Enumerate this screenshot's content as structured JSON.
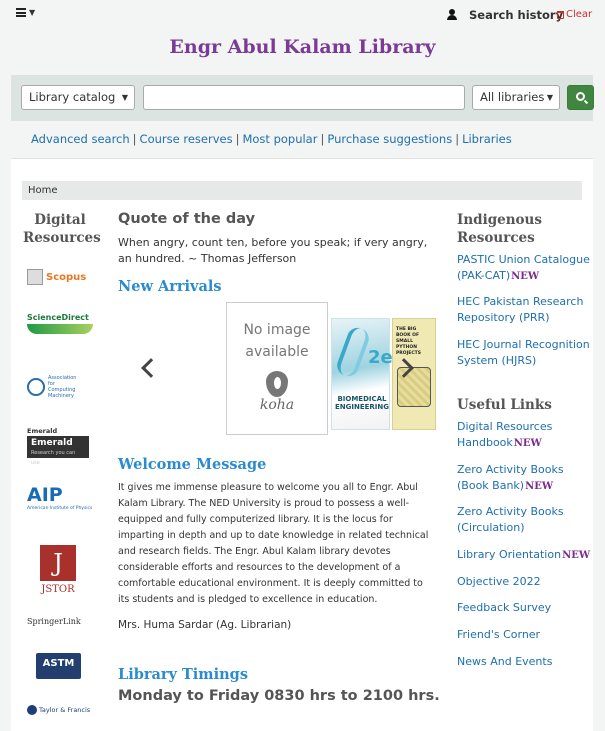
{
  "header": {
    "search_history": "Search history",
    "clear": "Clear"
  },
  "library_title": "Engr Abul Kalam Library",
  "search": {
    "scope": "Library catalog",
    "query": "",
    "branch": "All libraries"
  },
  "more_searches": [
    "Advanced search",
    "Course reserves",
    "Most popular",
    "Purchase suggestions",
    "Libraries"
  ],
  "breadcrumb": "Home",
  "left_col": {
    "heading_l1": "Digital",
    "heading_l2": "Resources",
    "logos": {
      "scopus": "Scopus",
      "sciencedirect": "ScienceDirect",
      "acm": "Association for Computing Machinery",
      "emerald_top": "Emerald",
      "emerald_name": "Emerald",
      "emerald_tag": "Research you can use",
      "aip": "AIP",
      "aip_sub": "American Institute of Physics",
      "jstor": "JSTOR",
      "springer": "SpringerLink",
      "astm": "ASTM",
      "tf": "Taylor & Francis"
    }
  },
  "main": {
    "quote_heading": "Quote of the day",
    "quote_text": "When angry, count ten, before you speak; if very angry, an hundred. ~ Thomas Jefferson",
    "new_arrivals_heading": "New Arrivals",
    "carousel": {
      "no_image_1": "No image",
      "no_image_2": "available",
      "koha": "koha",
      "book1_title": "BIOMEDICAL ENGINEERING",
      "book1_edition": "2e",
      "book2_title": "THE BIG BOOK OF SMALL PYTHON PROJECTS"
    },
    "welcome_heading": "Welcome Message",
    "welcome_text": "It gives me immense pleasure to welcome you all to Engr. Abul Kalam Library. The NED University is proud to possess a well-equipped and fully computerized library. It is the locus for imparting in depth and up to date knowledge in related technical and research fields. The Engr. Abul Kalam library devotes considerable efforts and resources to the development of a comfortable educational environment. It is deeply committed to its students and is pledged to excellence in education.",
    "signature": "Mrs. Huma Sardar (Ag. Librarian)",
    "timings_heading": "Library Timings",
    "timings_text": "Monday to Friday 0830 hrs to 2100 hrs."
  },
  "right_col": {
    "indigenous_l1": "Indigenous",
    "indigenous_l2": "Resources",
    "links_a": [
      "PASTIC Union Catalogue (PAK-CAT)",
      "HEC Pakistan  Research Repository (PRR)",
      "HEC Journal Recognition System (HJRS)"
    ],
    "useful_heading": "Useful Links",
    "links_b": [
      "Digital Resources Handbook",
      "Zero Activity Books (Book Bank)",
      "Zero Activity Books (Circulation)",
      "Library Orientation",
      "Objective 2022",
      "Feedback Survey",
      "Friend's Corner",
      "News And Events"
    ],
    "new_badge": "NEW"
  },
  "colors": {
    "title": "#7b3a96",
    "link": "#1e6fae",
    "section_heading": "#2b8bcf",
    "search_button": "#408540",
    "new_badge": "#7b2c8a"
  }
}
